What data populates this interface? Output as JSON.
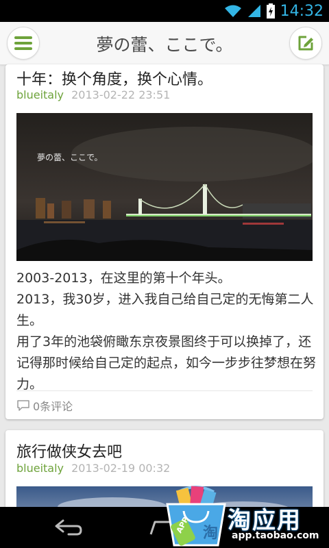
{
  "status_bar": {
    "time": "14:32"
  },
  "action_bar": {
    "title": "夢の蕾、ここで。",
    "menu_icon": "hamburger-menu-icon",
    "compose_icon": "compose-edit-icon"
  },
  "posts": [
    {
      "title": "十年：换个角度，换个心情。",
      "author": "blueitaly",
      "date": "2013-02-22 23:51",
      "image_caption": "夢の蕾、ここで。",
      "body": [
        "2003-2013，在这里的第十个年头。",
        "2013，我30岁，进入我自己给自己定的无悔第二人生。",
        "用了3年的池袋俯瞰东京夜景图终于可以换掉了，还记得那时候给自己定的起点，如今一步步往梦想在努力。"
      ],
      "comments": "0条评论"
    },
    {
      "title": "旅行做侠女去吧",
      "author": "blueitaly",
      "date": "2013-02-19 00:32"
    }
  ],
  "watermark": {
    "brand": "淘应用",
    "url": "app.taobao.com",
    "badge_text": "APP",
    "badge_char": "淘"
  },
  "colors": {
    "accent_green": "#6ea33b",
    "status_blue": "#33b5e5"
  }
}
